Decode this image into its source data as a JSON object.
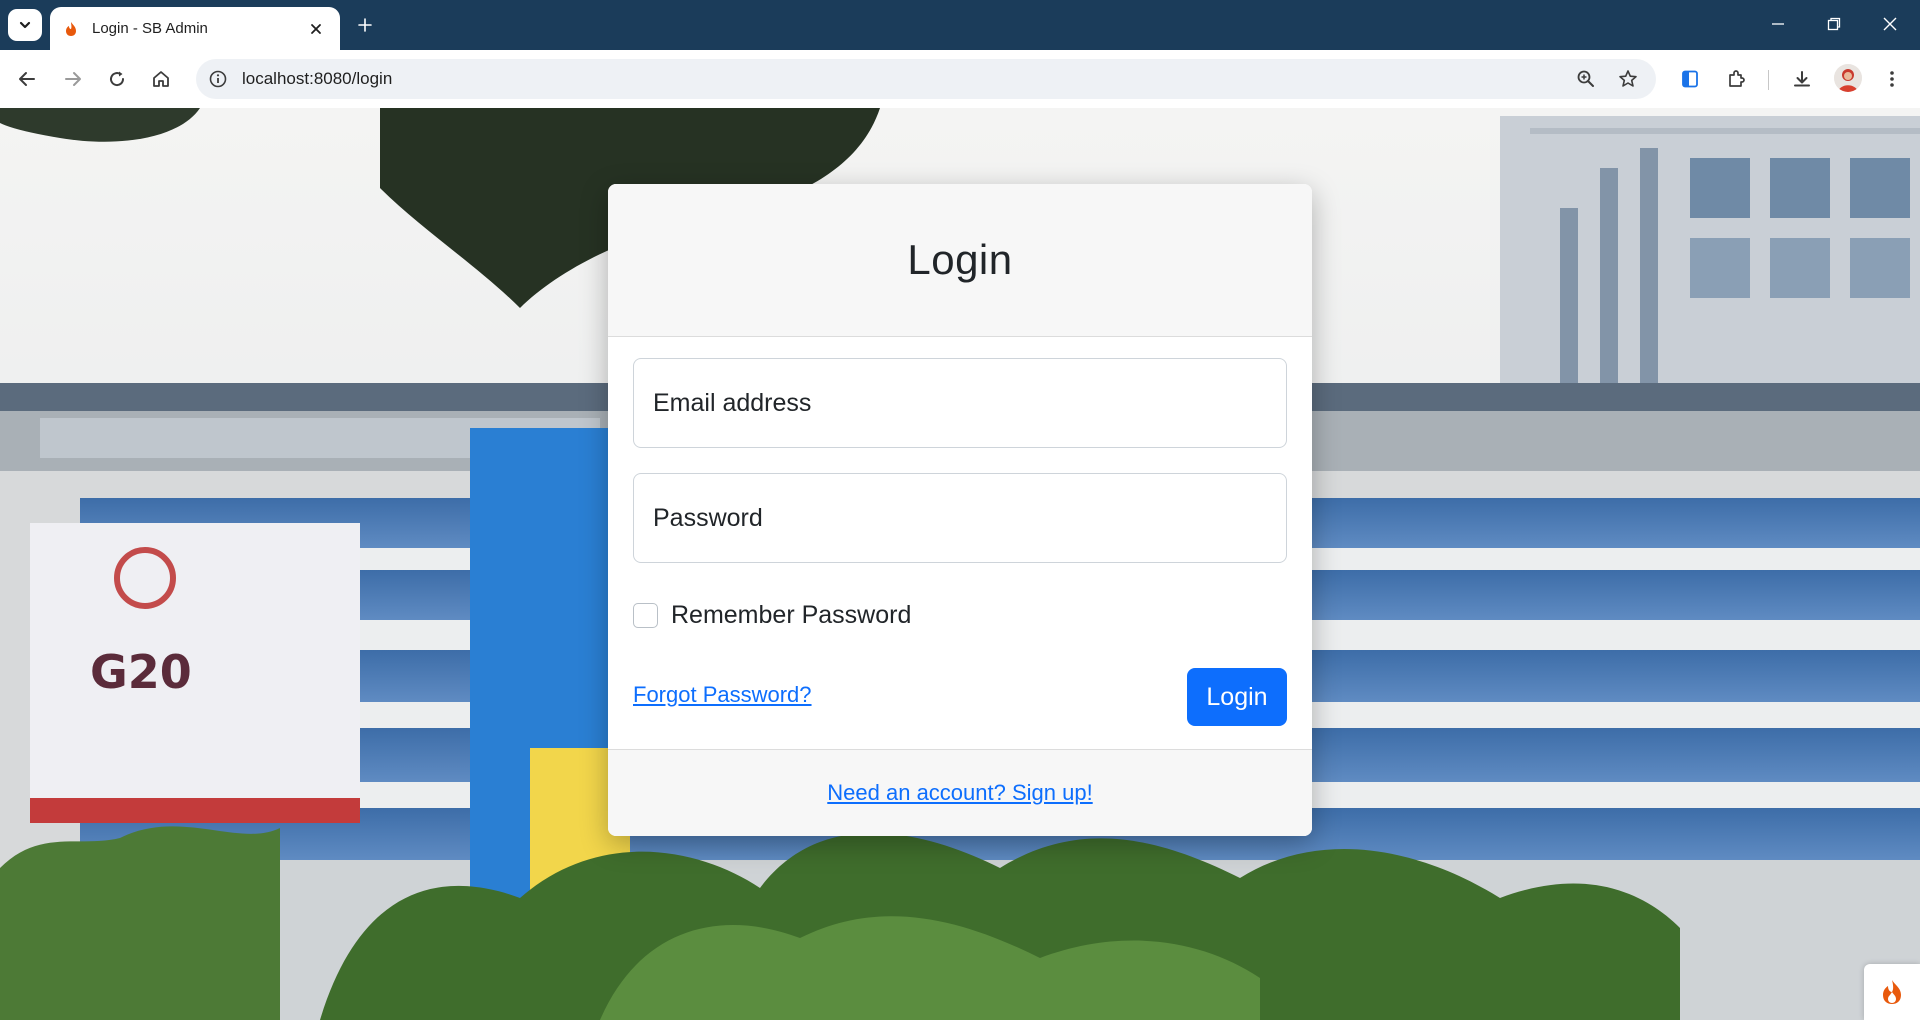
{
  "browser": {
    "tab_title": "Login - SB Admin",
    "url": "localhost:8080/login",
    "icons": [
      "tab-search-icon",
      "favicon-flame-icon",
      "close-icon",
      "plus-icon",
      "minimize-icon",
      "restore-icon",
      "back-icon",
      "forward-icon",
      "reload-icon",
      "home-icon",
      "site-info-icon",
      "zoom-icon",
      "star-icon",
      "sidebar-icon",
      "extensions-icon",
      "download-icon",
      "profile-avatar",
      "kebab-menu-icon"
    ]
  },
  "login": {
    "title": "Login",
    "email_placeholder": "Email address",
    "password_placeholder": "Password",
    "remember_label": "Remember Password",
    "forgot_link": "Forgot Password?",
    "submit_label": "Login",
    "signup_link": "Need an account? Sign up!"
  },
  "colors": {
    "primary": "#0d6efd",
    "chrome_frame": "#1b3c5a",
    "card_header_bg": "#f7f7f7"
  }
}
